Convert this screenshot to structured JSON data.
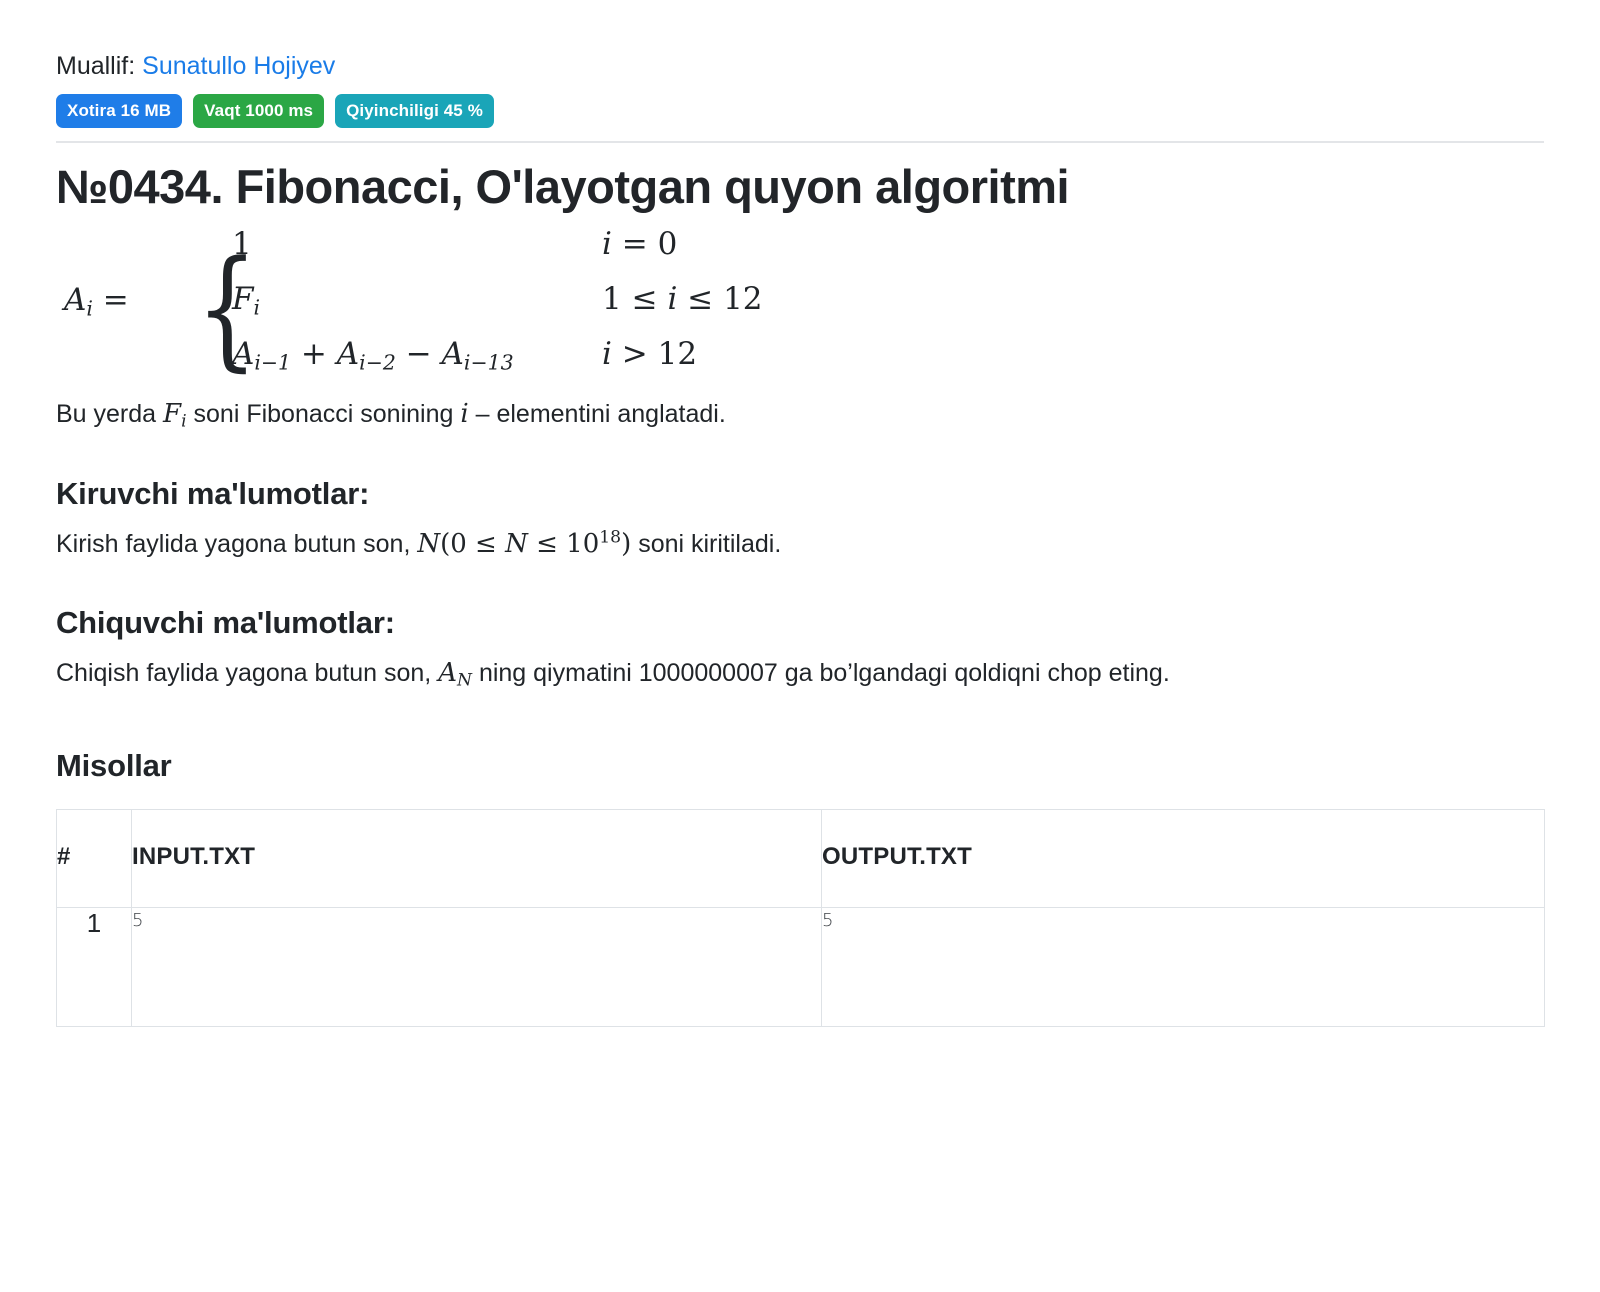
{
  "author": {
    "prefix": "Muallif:",
    "name": "Sunatullo Hojiyev",
    "link_color": "#1a7ce8"
  },
  "badges": [
    {
      "name": "memory",
      "label": "Xotira 16 MB",
      "color": "#1f7de8"
    },
    {
      "name": "time",
      "label": "Vaqt 1000 ms",
      "color": "#2ba745"
    },
    {
      "name": "difficulty",
      "label": "Qiyinchiligi 45 %",
      "color": "#1aa5b8"
    }
  ],
  "title": "№0434. Fibonacci, O'layotgan quyon algoritmi",
  "formula": {
    "lhs_var": "A",
    "lhs_sub": "i",
    "equals": "=",
    "cases": [
      {
        "value": "1",
        "value_sub": "",
        "condition": "i = 0"
      },
      {
        "value": "F",
        "value_sub": "i",
        "condition": "1 ≤ i ≤ 12"
      },
      {
        "value": "A i−1 + A i−2 − A i−13",
        "value_sub": "",
        "condition": "i > 12"
      }
    ],
    "case3_terms": [
      {
        "var": "A",
        "sub": "i−1",
        "op": "+"
      },
      {
        "var": "A",
        "sub": "i−2",
        "op": "−"
      },
      {
        "var": "A",
        "sub": "i−13",
        "op": ""
      }
    ]
  },
  "note": {
    "part1": "Bu yerda ",
    "math_var": "F",
    "math_sub": "i",
    "part2": " soni Fibonacci sonining ",
    "math_var2": "i",
    "part3": " – elementini anglatadi."
  },
  "input_section": {
    "heading": "Kiruvchi ma'lumotlar:",
    "text_part1": "Kirish faylida yagona butun son, ",
    "math_var": "N",
    "math_range_open": "(0 ≤ ",
    "math_var2": "N",
    "math_le": " ≤ 10",
    "math_exp": "18",
    "math_close": ")",
    "text_part2": " soni kiritiladi."
  },
  "output_section": {
    "heading": "Chiquvchi ma'lumotlar:",
    "text_part1": "Chiqish faylida yagona butun son, ",
    "math_var": "A",
    "math_sub": "N",
    "text_part2": " ning qiymatini 1000000007 ga bo’lgandagi qoldiqni chop eting."
  },
  "examples": {
    "heading": "Misollar",
    "columns": [
      "#",
      "INPUT.TXT",
      "OUTPUT.TXT"
    ],
    "rows": [
      {
        "index": "1",
        "input": "5",
        "output": "5"
      }
    ]
  }
}
